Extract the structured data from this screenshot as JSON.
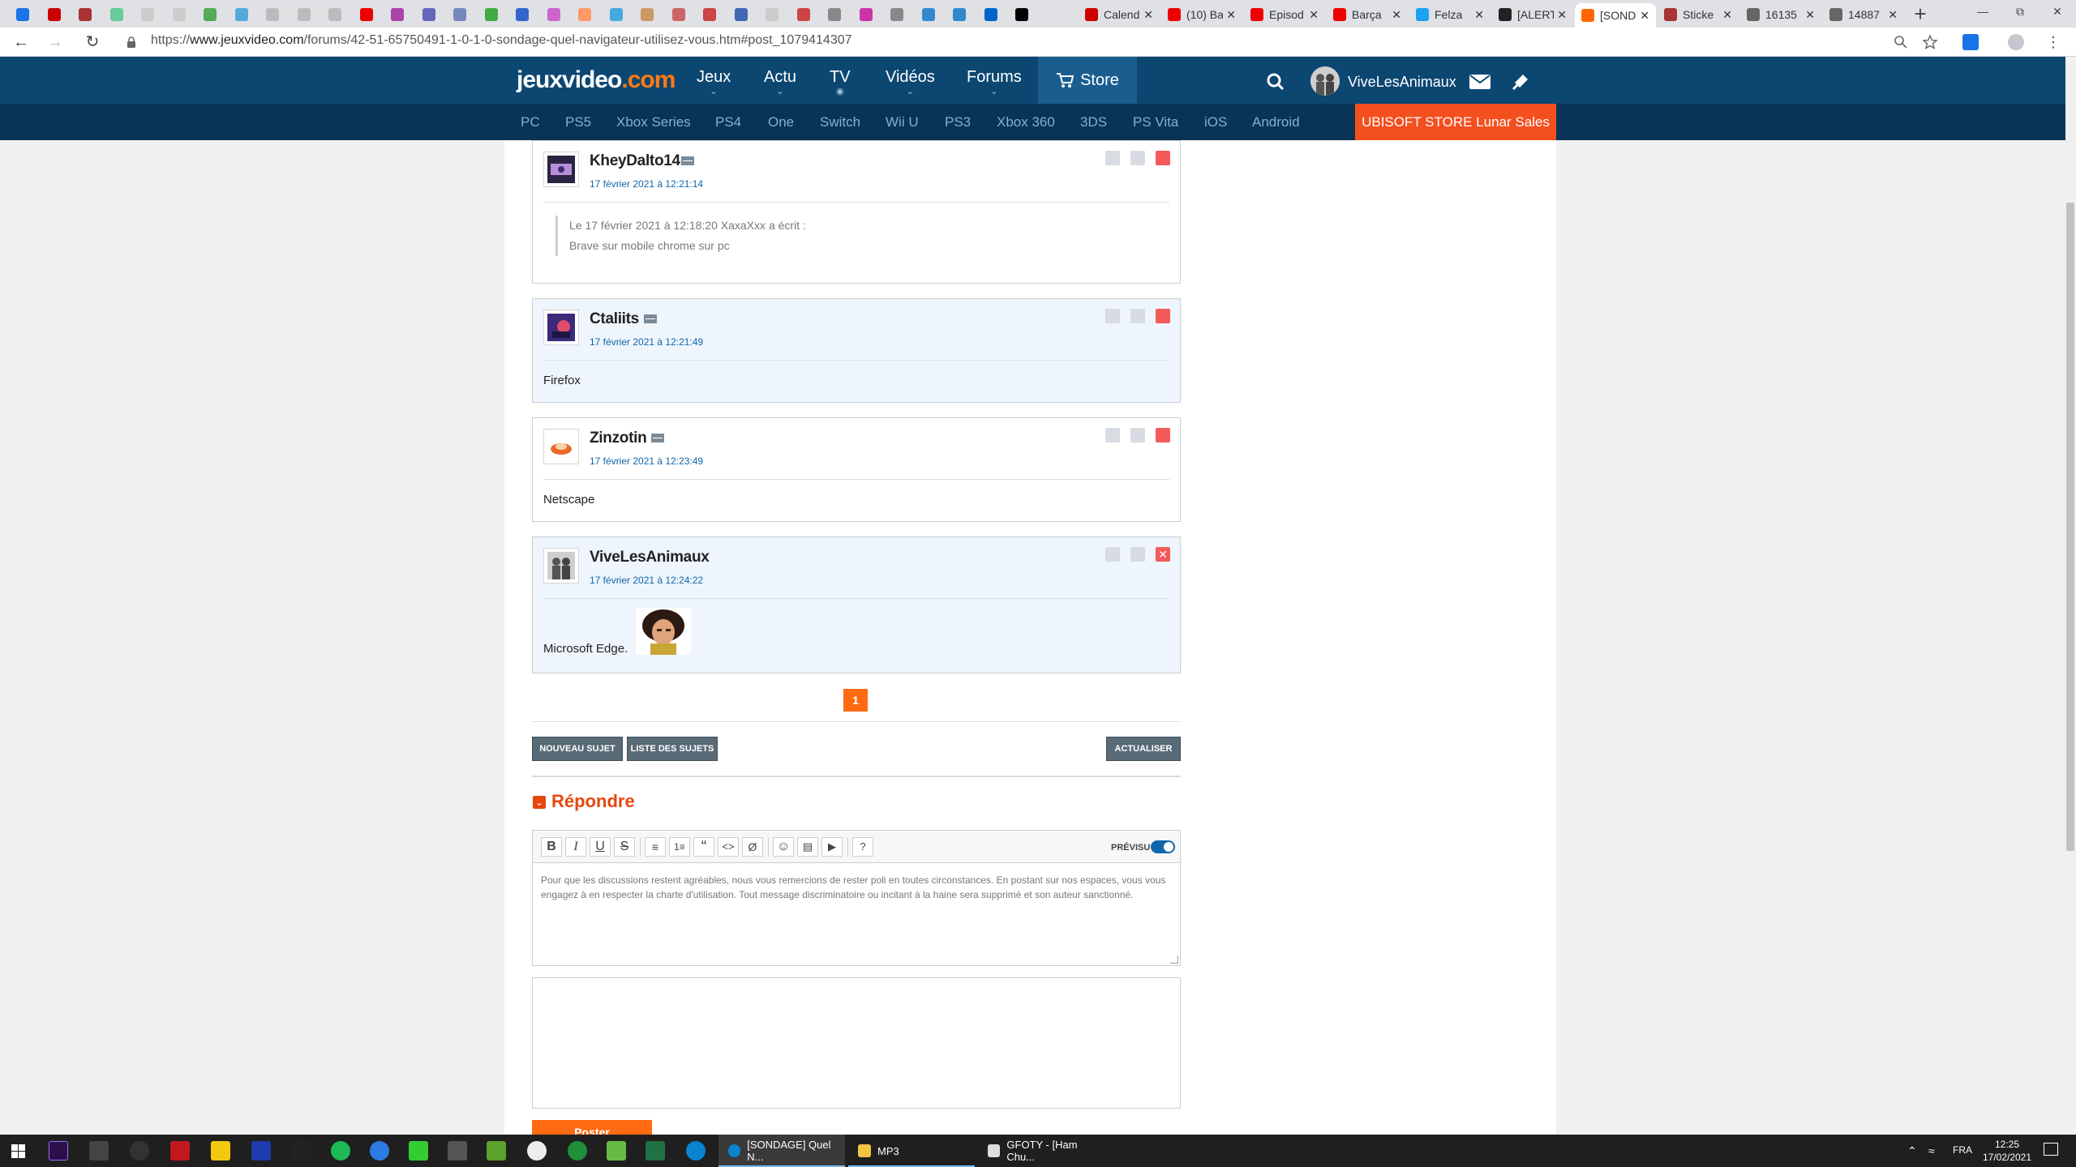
{
  "browser": {
    "tabs_titled": [
      {
        "title": "Calend",
        "color": "#c00"
      },
      {
        "title": "(10) Ba",
        "color": "#e00"
      },
      {
        "title": "Episod",
        "color": "#e00"
      },
      {
        "title": "Barça",
        "color": "#e00"
      },
      {
        "title": "Felza",
        "color": "#1da1f2"
      },
      {
        "title": "[ALERT",
        "color": "#222"
      },
      {
        "title": "[SOND",
        "color": "#f60"
      },
      {
        "title": "Sticke",
        "color": "#a33"
      },
      {
        "title": "16135",
        "color": "#666"
      },
      {
        "title": "14887",
        "color": "#666"
      }
    ],
    "url_prefix": "https://",
    "url_host": "www.jeuxvideo.com",
    "url_path": "/forums/42-51-65750491-1-0-1-0-sondage-quel-navigateur-utilisez-vous.htm#post_1079414307"
  },
  "site": {
    "logo_main": "jeuxvideo",
    "logo_suffix": ".com",
    "nav": [
      "Jeux",
      "Actu",
      "TV",
      "Vidéos",
      "Forums"
    ],
    "store": "Store",
    "username": "ViveLesAnimaux",
    "platforms": [
      "PC",
      "PS5",
      "Xbox Series",
      "PS4",
      "One",
      "Switch",
      "Wii U",
      "PS3",
      "Xbox 360",
      "3DS",
      "PS Vita",
      "iOS",
      "Android"
    ],
    "promo": "UBISOFT STORE Lunar Sales"
  },
  "posts": [
    {
      "author": "KheyDalto14",
      "date": "17 février 2021 à 12:21:14",
      "quote_header": "Le 17 février 2021 à 12:18:20 XaxaXxx a écrit :",
      "quote_text": "Brave sur mobile chrome sur pc",
      "body": ""
    },
    {
      "author": "Ctaliits",
      "date": "17 février 2021 à 12:21:49",
      "body": "Firefox"
    },
    {
      "author": "Zinzotin",
      "date": "17 février 2021 à 12:23:49",
      "body": "Netscape"
    },
    {
      "author": "ViveLesAnimaux",
      "date": "17 février 2021 à 12:24:22",
      "body": "Microsoft Edge."
    }
  ],
  "pagination": {
    "current": "1"
  },
  "buttons": {
    "new_topic": "Nouveau sujet",
    "topic_list": "Liste des sujets",
    "refresh": "Actualiser",
    "post": "Poster"
  },
  "reply": {
    "title": "Répondre",
    "preview_label": "PRÉVISU",
    "placeholder": "Pour que les discussions restent agréables, nous vous remercions de rester poli en toutes circonstances. En postant sur nos espaces, vous vous engagez à en respecter la charte d'utilisation. Tout message discriminatoire ou incitant à la haine sera supprimé et son auteur sanctionné."
  },
  "taskbar": {
    "apps": [
      {
        "title": "[SONDAGE] Quel N...",
        "color": "#0a84d0"
      },
      {
        "title": "MP3",
        "color": "#f4c542"
      },
      {
        "title": "GFOTY - [Ham Chu...",
        "color": "#ddd"
      }
    ],
    "lang": "FRA",
    "time": "12:25",
    "date": "17/02/2021"
  },
  "colors": {
    "header": "#0c4771",
    "subheader": "#083456",
    "accent": "#ff6a13",
    "promo": "#f44f1f",
    "link": "#1166aa"
  }
}
